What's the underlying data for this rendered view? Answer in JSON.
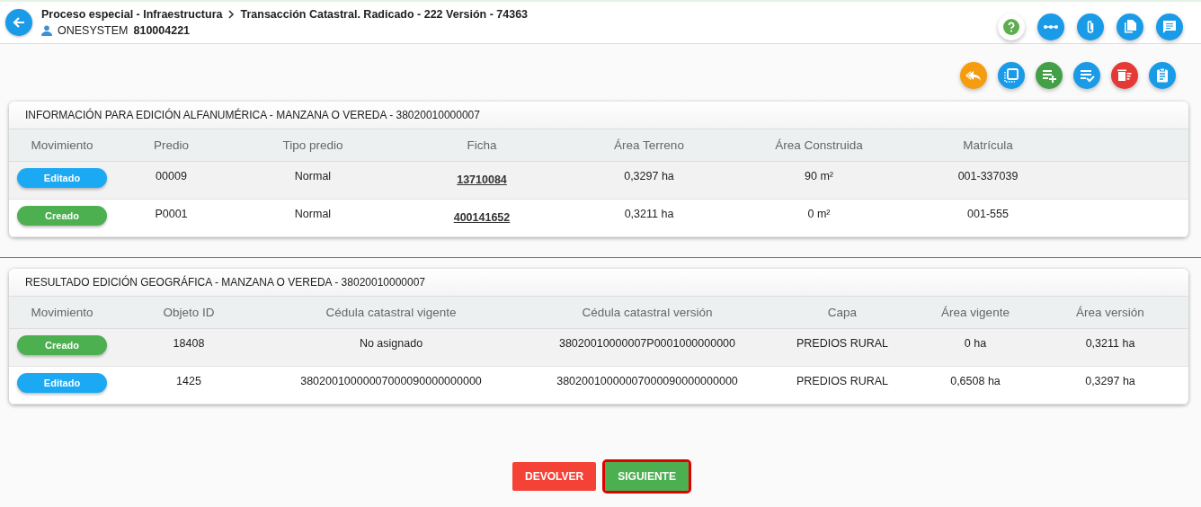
{
  "header": {
    "breadcrumb": [
      "Proceso especial - Infraestructura",
      "Transacción Catastral. Radicado - 222 Versión - 74363"
    ],
    "user": "ONESYSTEM",
    "user_id": "810004221"
  },
  "header_actions": [
    {
      "kind": "help"
    },
    {
      "kind": "dots"
    },
    {
      "kind": "clip"
    },
    {
      "kind": "copy"
    },
    {
      "kind": "chat"
    }
  ],
  "toolbar_actions": [
    {
      "kind": "reply"
    },
    {
      "kind": "frame"
    },
    {
      "kind": "add"
    },
    {
      "kind": "check"
    },
    {
      "kind": "delete"
    },
    {
      "kind": "clipboard"
    }
  ],
  "panels": [
    {
      "title": "INFORMACIÓN PARA EDICIÓN ALFANUMÉRICA - MANZANA O VEREDA - 38020010000007",
      "columns": [
        "Movimiento",
        "Predio",
        "Tipo predio",
        "Ficha",
        "Área Terreno",
        "Área Construida",
        "Matrícula"
      ],
      "rows": [
        {
          "cells": [
            {
              "text": "Editado",
              "kind": "edited"
            },
            "00009",
            "Normal",
            {
              "text": "13710084",
              "kind": "link"
            },
            "0,3297 ha",
            "90 m²",
            "001-337039"
          ]
        },
        {
          "cells": [
            {
              "text": "Creado",
              "kind": "created"
            },
            "P0001",
            "Normal",
            {
              "text": "400141652",
              "kind": "link"
            },
            "0,3211 ha",
            "0 m²",
            "001-555"
          ]
        }
      ]
    },
    {
      "title": "RESULTADO EDICIÓN GEOGRÁFICA - MANZANA O VEREDA - 38020010000007",
      "columns": [
        "Movimiento",
        "Objeto ID",
        "Cédula catastral vigente",
        "Cédula catastral versión",
        "Capa",
        "Área vigente",
        "Área versión"
      ],
      "rows": [
        {
          "cells": [
            {
              "text": "Creado",
              "kind": "created"
            },
            "18408",
            "No asignado",
            "38020010000007P0001000000000",
            "PREDIOS RURAL",
            "0 ha",
            "0,3211 ha"
          ]
        },
        {
          "cells": [
            {
              "text": "Editado",
              "kind": "edited"
            },
            "1425",
            "38020010000007000090000000000",
            "38020010000007000090000000000",
            "PREDIOS RURAL",
            "0,6508 ha",
            "0,3297 ha"
          ]
        }
      ]
    }
  ],
  "buttons": [
    {
      "label": "DEVOLVER",
      "kind": "return",
      "highlighted": false
    },
    {
      "label": "SIGUIENTE",
      "kind": "next",
      "highlighted": true
    }
  ]
}
